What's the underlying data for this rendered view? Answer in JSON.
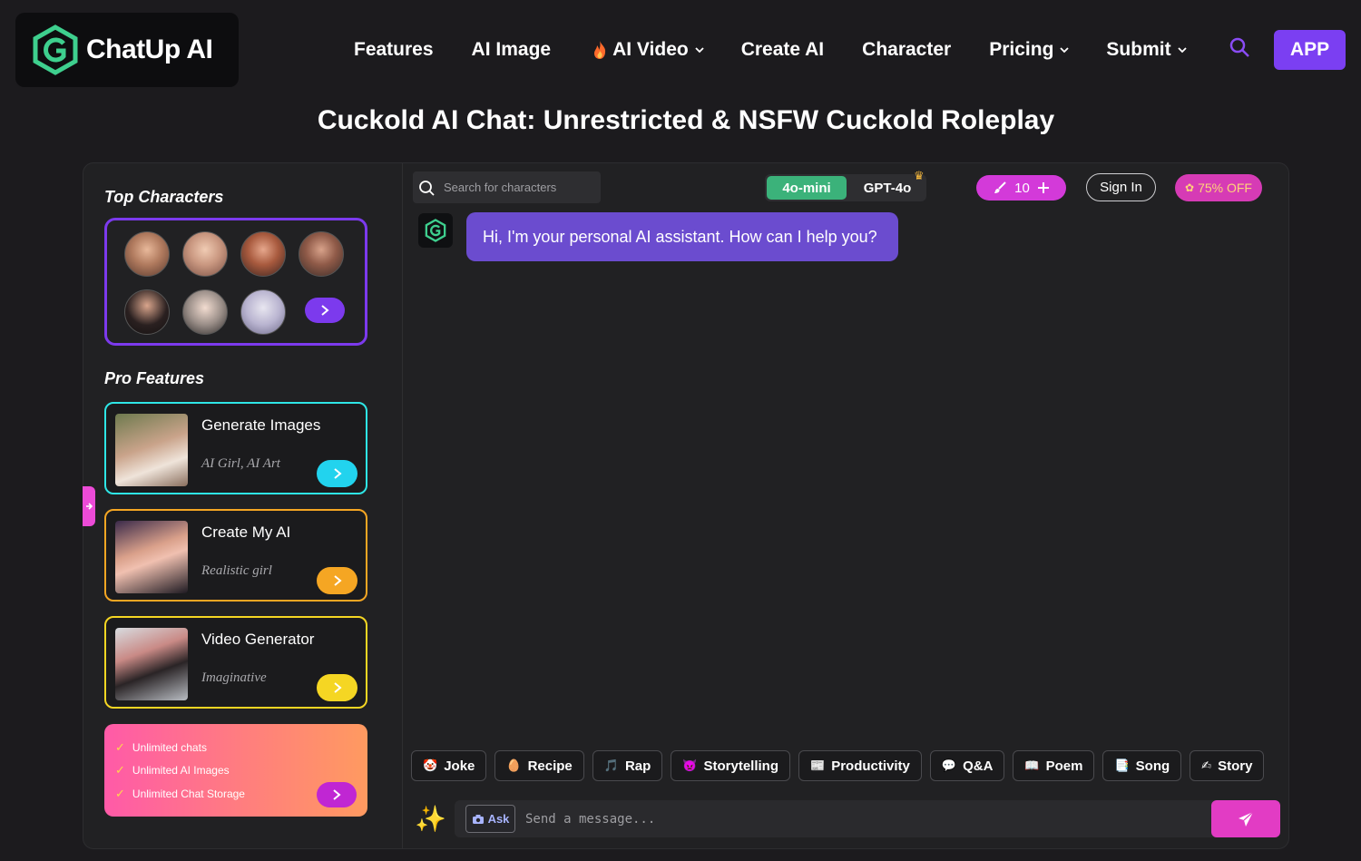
{
  "header": {
    "logo_text": "ChatUp AI",
    "nav": [
      {
        "label": "Features",
        "has_dropdown": false,
        "icon": ""
      },
      {
        "label": "AI Image",
        "has_dropdown": false,
        "icon": ""
      },
      {
        "label": "AI Video",
        "has_dropdown": true,
        "icon": "fire-icon"
      },
      {
        "label": "Create AI",
        "has_dropdown": false,
        "icon": ""
      },
      {
        "label": "Character",
        "has_dropdown": false,
        "icon": ""
      },
      {
        "label": "Pricing",
        "has_dropdown": true,
        "icon": ""
      },
      {
        "label": "Submit",
        "has_dropdown": true,
        "icon": ""
      }
    ],
    "app_button": "APP"
  },
  "page_title": "Cuckold AI Chat: Unrestricted & NSFW Cuckold Roleplay",
  "sidebar": {
    "top_characters_heading": "Top Characters",
    "pro_features_heading": "Pro Features",
    "pro_features": [
      {
        "title": "Generate Images",
        "subtitle": "AI Girl, AI Art",
        "accent": "#2ee6e6"
      },
      {
        "title": "Create My AI",
        "subtitle": "Realistic girl",
        "accent": "#f5a623"
      },
      {
        "title": "Video Generator",
        "subtitle": "Imaginative",
        "accent": "#f5d623"
      }
    ],
    "promo": [
      "Unlimited chats",
      "Unlimited AI Images",
      "Unlimited Chat Storage"
    ]
  },
  "chat": {
    "search_placeholder": "Search for characters",
    "models": [
      "4o-mini",
      "GPT-4o"
    ],
    "credits": "10",
    "sign_in": "Sign In",
    "discount": "75% OFF",
    "welcome_message": "Hi, I'm your personal AI assistant. How can I help you?",
    "quick_prompts": [
      {
        "label": "Joke",
        "icon": "🤡"
      },
      {
        "label": "Recipe",
        "icon": "🥚"
      },
      {
        "label": "Rap",
        "icon": "🎵"
      },
      {
        "label": "Storytelling",
        "icon": "👿"
      },
      {
        "label": "Productivity",
        "icon": "📰"
      },
      {
        "label": "Q&A",
        "icon": "💬"
      },
      {
        "label": "Poem",
        "icon": "📖"
      },
      {
        "label": "Song",
        "icon": "📑"
      },
      {
        "label": "Story",
        "icon": "✍"
      }
    ],
    "ask_label": "Ask",
    "message_placeholder": "Send a message..."
  },
  "colors": {
    "brand_purple": "#7b3ff2",
    "brand_pink": "#e23cc4",
    "logo_green": "#3ecf8e"
  }
}
